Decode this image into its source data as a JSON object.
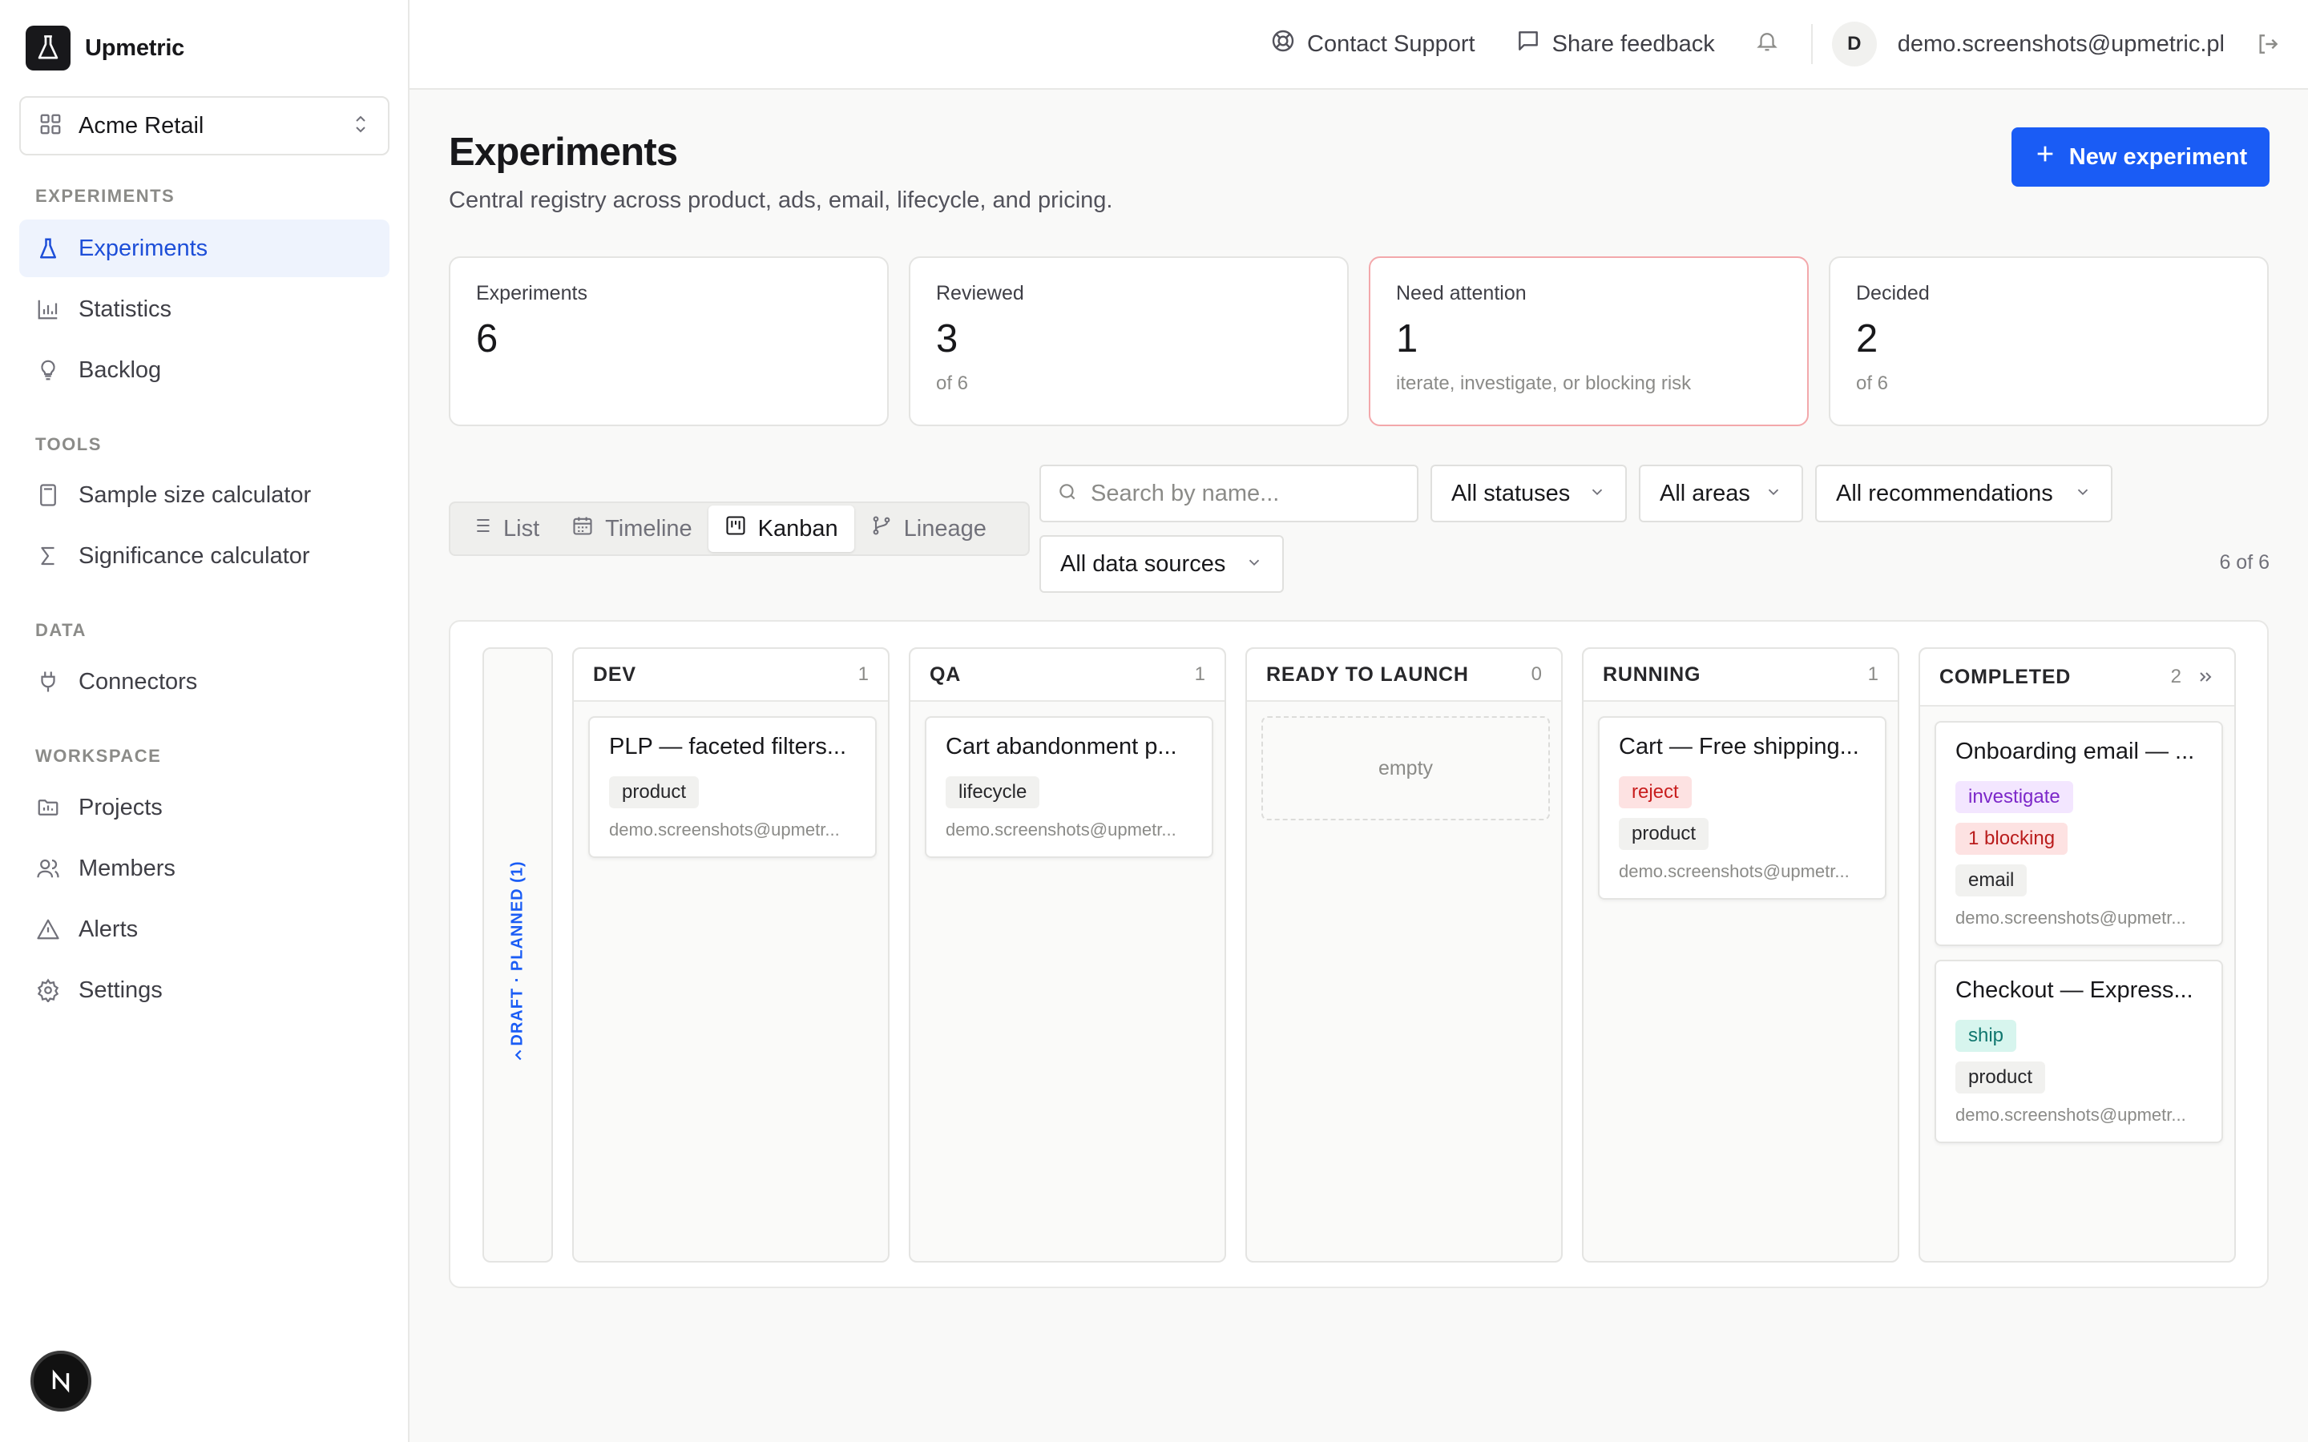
{
  "brand": {
    "name": "Upmetric"
  },
  "workspace": {
    "name": "Acme Retail"
  },
  "sidebar": {
    "sections": [
      {
        "title": "EXPERIMENTS",
        "items": [
          {
            "label": "Experiments",
            "icon": "flask-icon",
            "active": true
          },
          {
            "label": "Statistics",
            "icon": "bar-chart-icon"
          },
          {
            "label": "Backlog",
            "icon": "lightbulb-icon"
          }
        ]
      },
      {
        "title": "TOOLS",
        "items": [
          {
            "label": "Sample size calculator",
            "icon": "calculator-icon"
          },
          {
            "label": "Significance calculator",
            "icon": "sigma-icon"
          }
        ]
      },
      {
        "title": "DATA",
        "items": [
          {
            "label": "Connectors",
            "icon": "plug-icon"
          }
        ]
      },
      {
        "title": "WORKSPACE",
        "items": [
          {
            "label": "Projects",
            "icon": "folder-icon"
          },
          {
            "label": "Members",
            "icon": "users-icon"
          },
          {
            "label": "Alerts",
            "icon": "alert-triangle-icon"
          },
          {
            "label": "Settings",
            "icon": "gear-icon"
          }
        ]
      }
    ]
  },
  "topbar": {
    "contact_support": "Contact Support",
    "share_feedback": "Share feedback",
    "avatar_initial": "D",
    "user_email": "demo.screenshots@upmetric.pl"
  },
  "page": {
    "title": "Experiments",
    "subtitle": "Central registry across product, ads, email, lifecycle, and pricing.",
    "new_button": "New experiment"
  },
  "stats": [
    {
      "label": "Experiments",
      "value": "6",
      "note": ""
    },
    {
      "label": "Reviewed",
      "value": "3",
      "note": "of 6"
    },
    {
      "label": "Need attention",
      "value": "1",
      "note": "iterate, investigate, or blocking risk"
    },
    {
      "label": "Decided",
      "value": "2",
      "note": "of 6"
    }
  ],
  "views": [
    {
      "label": "List",
      "icon": "list-icon"
    },
    {
      "label": "Timeline",
      "icon": "calendar-icon"
    },
    {
      "label": "Kanban",
      "icon": "kanban-icon",
      "active": true
    },
    {
      "label": "Lineage",
      "icon": "git-branch-icon"
    }
  ],
  "filters": {
    "search_placeholder": "Search by name...",
    "status": "All statuses",
    "areas": "All areas",
    "recommendations": "All recommendations",
    "data_sources": "All data sources",
    "count": "6 of 6"
  },
  "kanban": {
    "collapsed_column": "DRAFT · PLANNED (1)",
    "columns": [
      {
        "title": "DEV",
        "count": "1",
        "cards": [
          {
            "title": "PLP — faceted filters...",
            "tags": [
              "product"
            ],
            "owner": "demo.screenshots@upmetr..."
          }
        ]
      },
      {
        "title": "QA",
        "count": "1",
        "cards": [
          {
            "title": "Cart abandonment p...",
            "tags": [
              "lifecycle"
            ],
            "owner": "demo.screenshots@upmetr..."
          }
        ]
      },
      {
        "title": "READY TO LAUNCH",
        "count": "0",
        "empty_text": "empty",
        "cards": []
      },
      {
        "title": "RUNNING",
        "count": "1",
        "cards": [
          {
            "title": "Cart — Free shipping...",
            "tags": [
              "reject",
              "product"
            ],
            "owner": "demo.screenshots@upmetr..."
          }
        ]
      },
      {
        "title": "COMPLETED",
        "count": "2",
        "cards": [
          {
            "title": "Onboarding email — ...",
            "tags": [
              "investigate",
              "1 blocking",
              "email"
            ],
            "owner": "demo.screenshots@upmetr..."
          },
          {
            "title": "Checkout — Express...",
            "tags": [
              "ship",
              "product"
            ],
            "owner": "demo.screenshots@upmetr..."
          }
        ]
      }
    ]
  },
  "colors": {
    "accent": "#1a5cf5",
    "alert_border": "#f3a8ab",
    "active_nav_bg": "#eef3fd"
  }
}
